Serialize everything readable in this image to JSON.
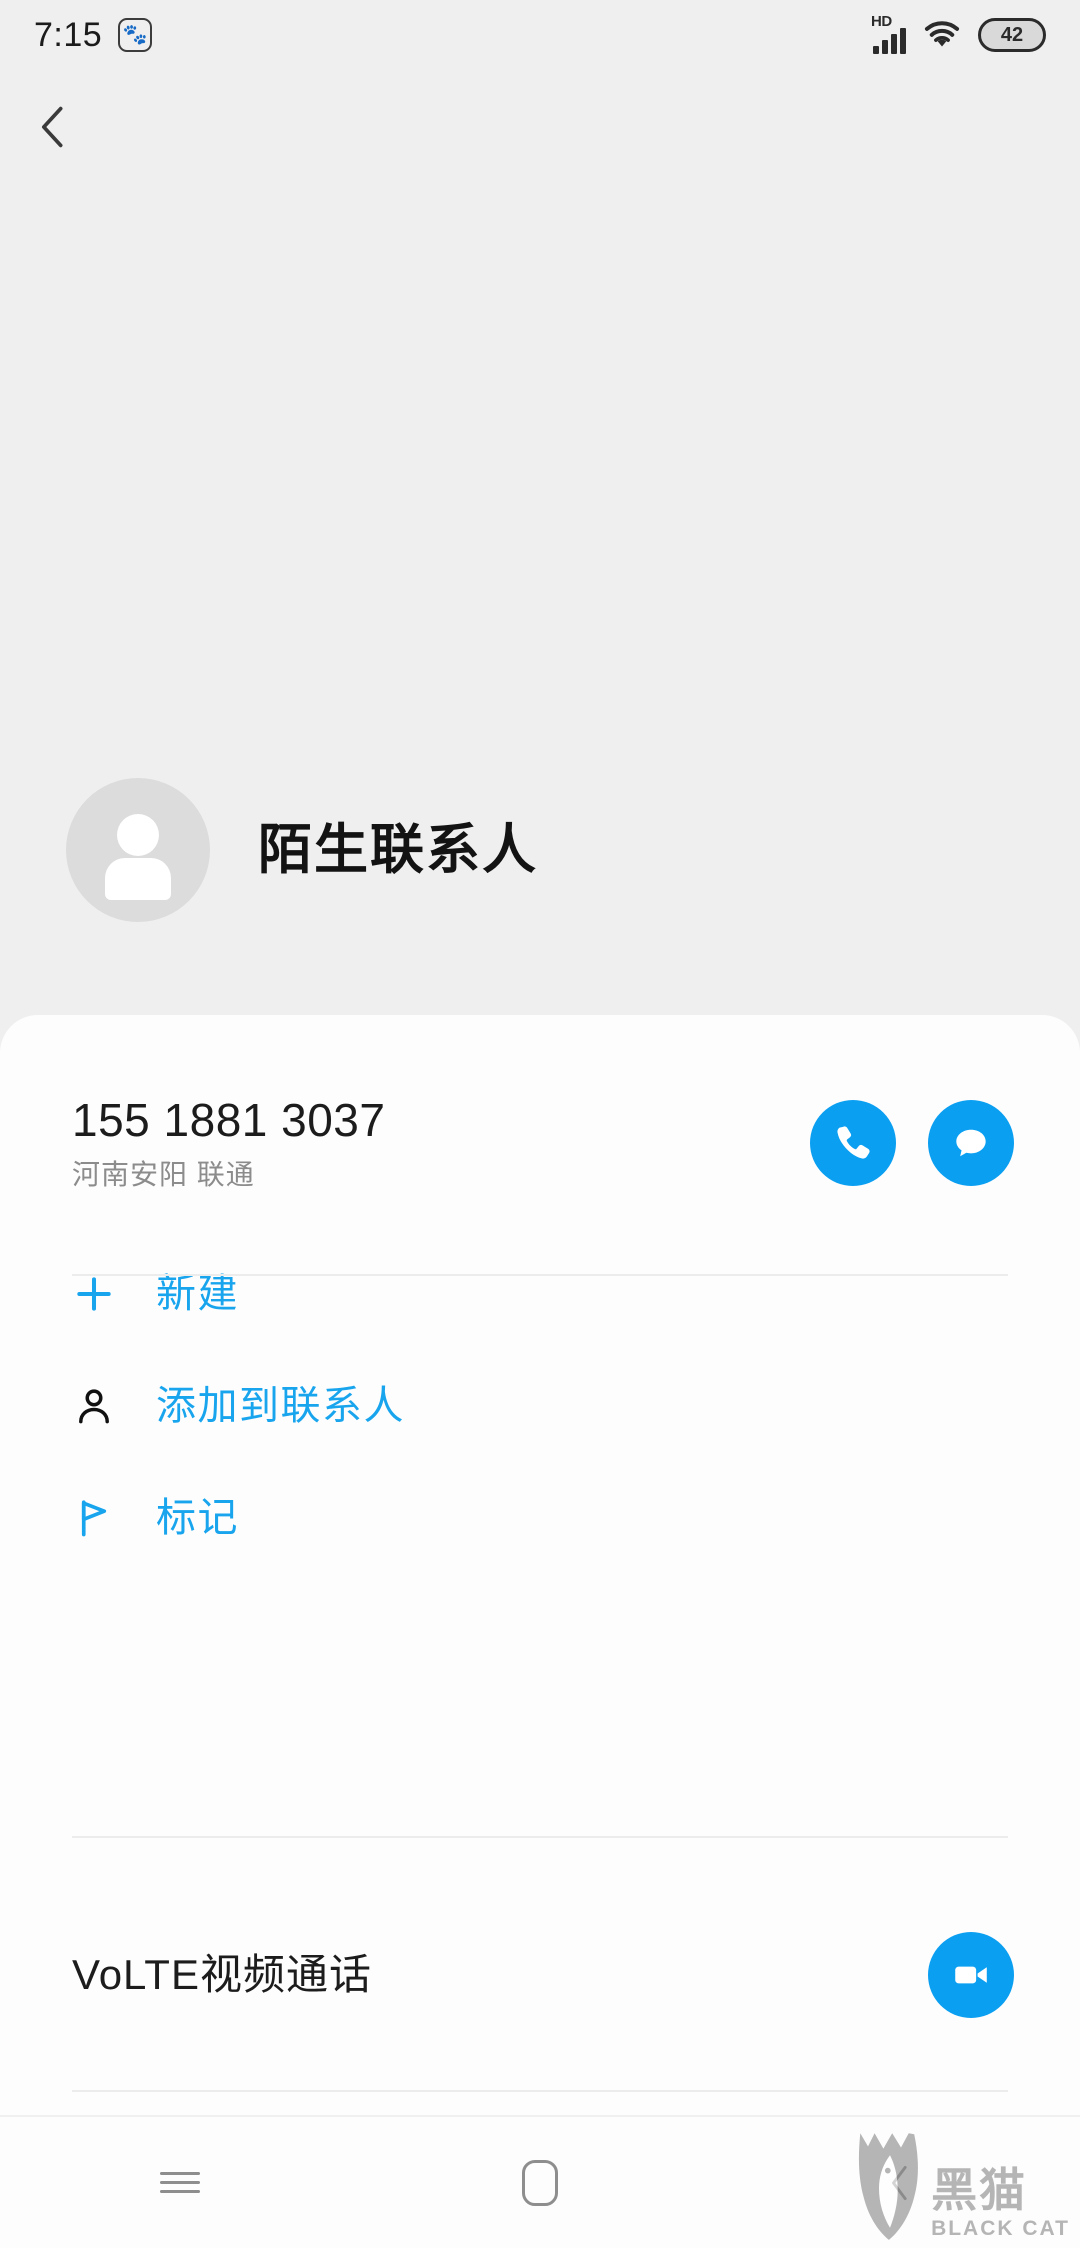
{
  "status_bar": {
    "time": "7:15",
    "app_icon": "baidu-paw-icon",
    "network_label": "HD",
    "signal_icon": "signal-bars-icon",
    "wifi_icon": "wifi-icon",
    "battery_level": "42"
  },
  "nav_top": {
    "back_icon": "chevron-left-icon"
  },
  "contact": {
    "name": "陌生联系人",
    "avatar_icon": "person-placeholder-icon"
  },
  "phone": {
    "number": "155 1881 3037",
    "carrier": "河南安阳 联通",
    "call_icon": "phone-icon",
    "message_icon": "message-bubble-icon"
  },
  "actions": [
    {
      "label": "新建",
      "icon": "plus-icon",
      "icon_color": "#19a5ee"
    },
    {
      "label": "添加到联系人",
      "icon": "person-outline-icon",
      "icon_color": "#111111"
    },
    {
      "label": "标记",
      "icon": "flag-icon",
      "icon_color": "#19a5ee"
    }
  ],
  "volte": {
    "label": "VoLTE视频通话",
    "icon": "video-camera-icon"
  },
  "nav_bar": {
    "menu_icon": "menu-hamburger-icon",
    "home_icon": "home-square-icon",
    "back_icon": "chevron-left-icon"
  },
  "watermark": {
    "cat_icon": "black-cat-logo-icon",
    "cn_text": "黑猫",
    "en_text": "BLACK CAT"
  },
  "colors": {
    "accent_blue": "#0b9ff2",
    "link_blue": "#19a5ee",
    "background": "#efefef",
    "card": "#fdfdfd"
  }
}
